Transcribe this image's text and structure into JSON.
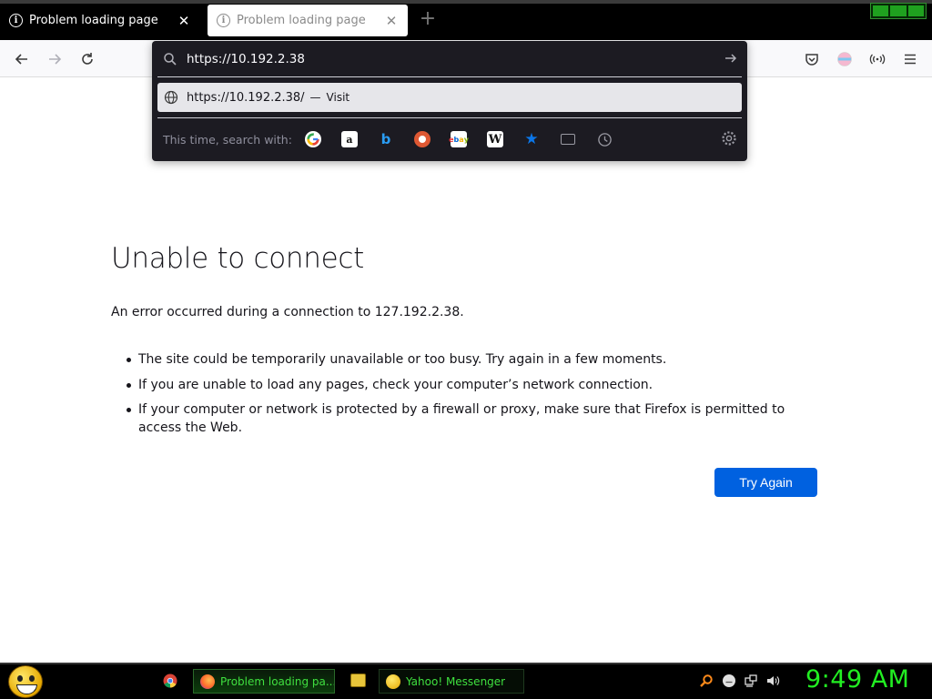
{
  "tabs": [
    {
      "title": "Problem loading page",
      "active": true
    },
    {
      "title": "Problem loading page",
      "active": false
    }
  ],
  "urlbar": {
    "value": "https://10.192.2.38",
    "suggestion_url": "https://10.192.2.38/",
    "suggestion_dash": "—",
    "suggestion_action": "Visit",
    "search_with_label": "This time, search with:",
    "engines": [
      "google-icon",
      "amazon-icon",
      "bing-icon",
      "duckduckgo-icon",
      "ebay-icon",
      "wikipedia-icon",
      "bookmarks-star-icon",
      "tabs-icon",
      "history-icon"
    ]
  },
  "error": {
    "title": "Unable to connect",
    "description": "An error occurred during a connection to 127.192.2.38.",
    "bullets": [
      "The site could be temporarily unavailable or too busy. Try again in a few moments.",
      "If you are unable to load any pages, check your computer’s network connection.",
      "If your computer or network is protected by a firewall or proxy, make sure that Firefox is permitted to access the Web."
    ],
    "button": "Try Again"
  },
  "taskbar": {
    "firefox_label": "Problem loading pa...",
    "yahoo_label": "Yahoo! Messenger",
    "clock": "9:49 AM"
  },
  "colors": {
    "accent": "#0061e0",
    "taskbar_text": "#3fe03f",
    "clock": "#22ee22",
    "urlbar_bg": "#1c1b22"
  }
}
